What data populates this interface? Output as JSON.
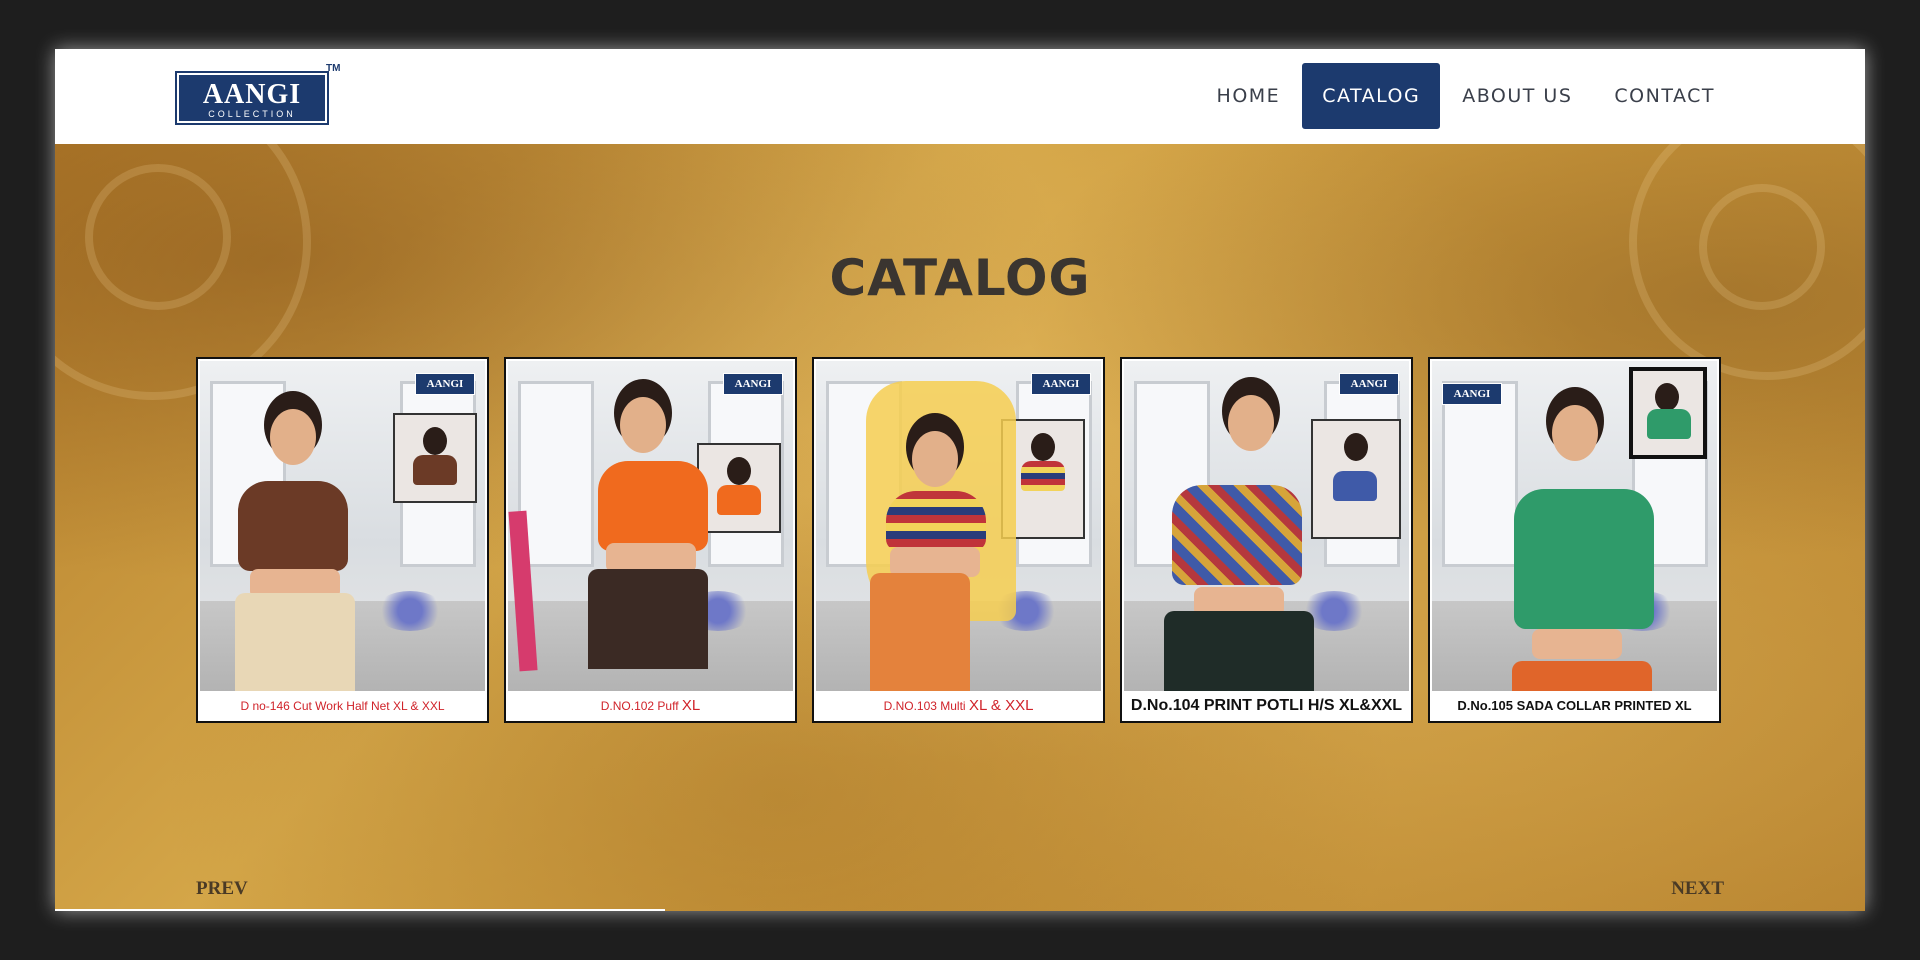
{
  "brand": {
    "name": "AANGI",
    "sub": "COLLECTION",
    "tm": "TM",
    "color": "#1c3a6e"
  },
  "nav": {
    "items": [
      {
        "label": "HOME",
        "active": false
      },
      {
        "label": "CATALOG",
        "active": true
      },
      {
        "label": "ABOUT US",
        "active": false
      },
      {
        "label": "CONTACT",
        "active": false
      }
    ]
  },
  "page": {
    "title": "CATALOG"
  },
  "cards": [
    {
      "caption": "D no-146 Cut Work Half Net XL & XXL",
      "caption_extra": "",
      "top_color": "#6b3a26",
      "bottom_color": "#e8d7b6"
    },
    {
      "caption": "D.NO.102 Puff",
      "caption_extra": "XL",
      "top_color": "#f06a1e",
      "bottom_color": "#3b2a24"
    },
    {
      "caption": "D.NO.103 Multi",
      "caption_extra": "XL & XXL",
      "top_color": "#c0343a",
      "bottom_color": "#e4823c"
    },
    {
      "caption": "D.No.104 PRINT POTLI H/S XL&XXL",
      "caption_extra": "",
      "top_color": "#3f5aa8",
      "bottom_color": "#1f2c28"
    },
    {
      "caption": "D.No.105 SADA COLLAR PRINTED XL",
      "caption_extra": "",
      "top_color": "#2f9b6a",
      "bottom_color": "#e0652a"
    }
  ],
  "pager": {
    "prev": "PREV",
    "next": "NEXT"
  },
  "colors": {
    "accent": "#1c3a6e",
    "title": "#3a3530",
    "caption_red": "#d0232a"
  }
}
